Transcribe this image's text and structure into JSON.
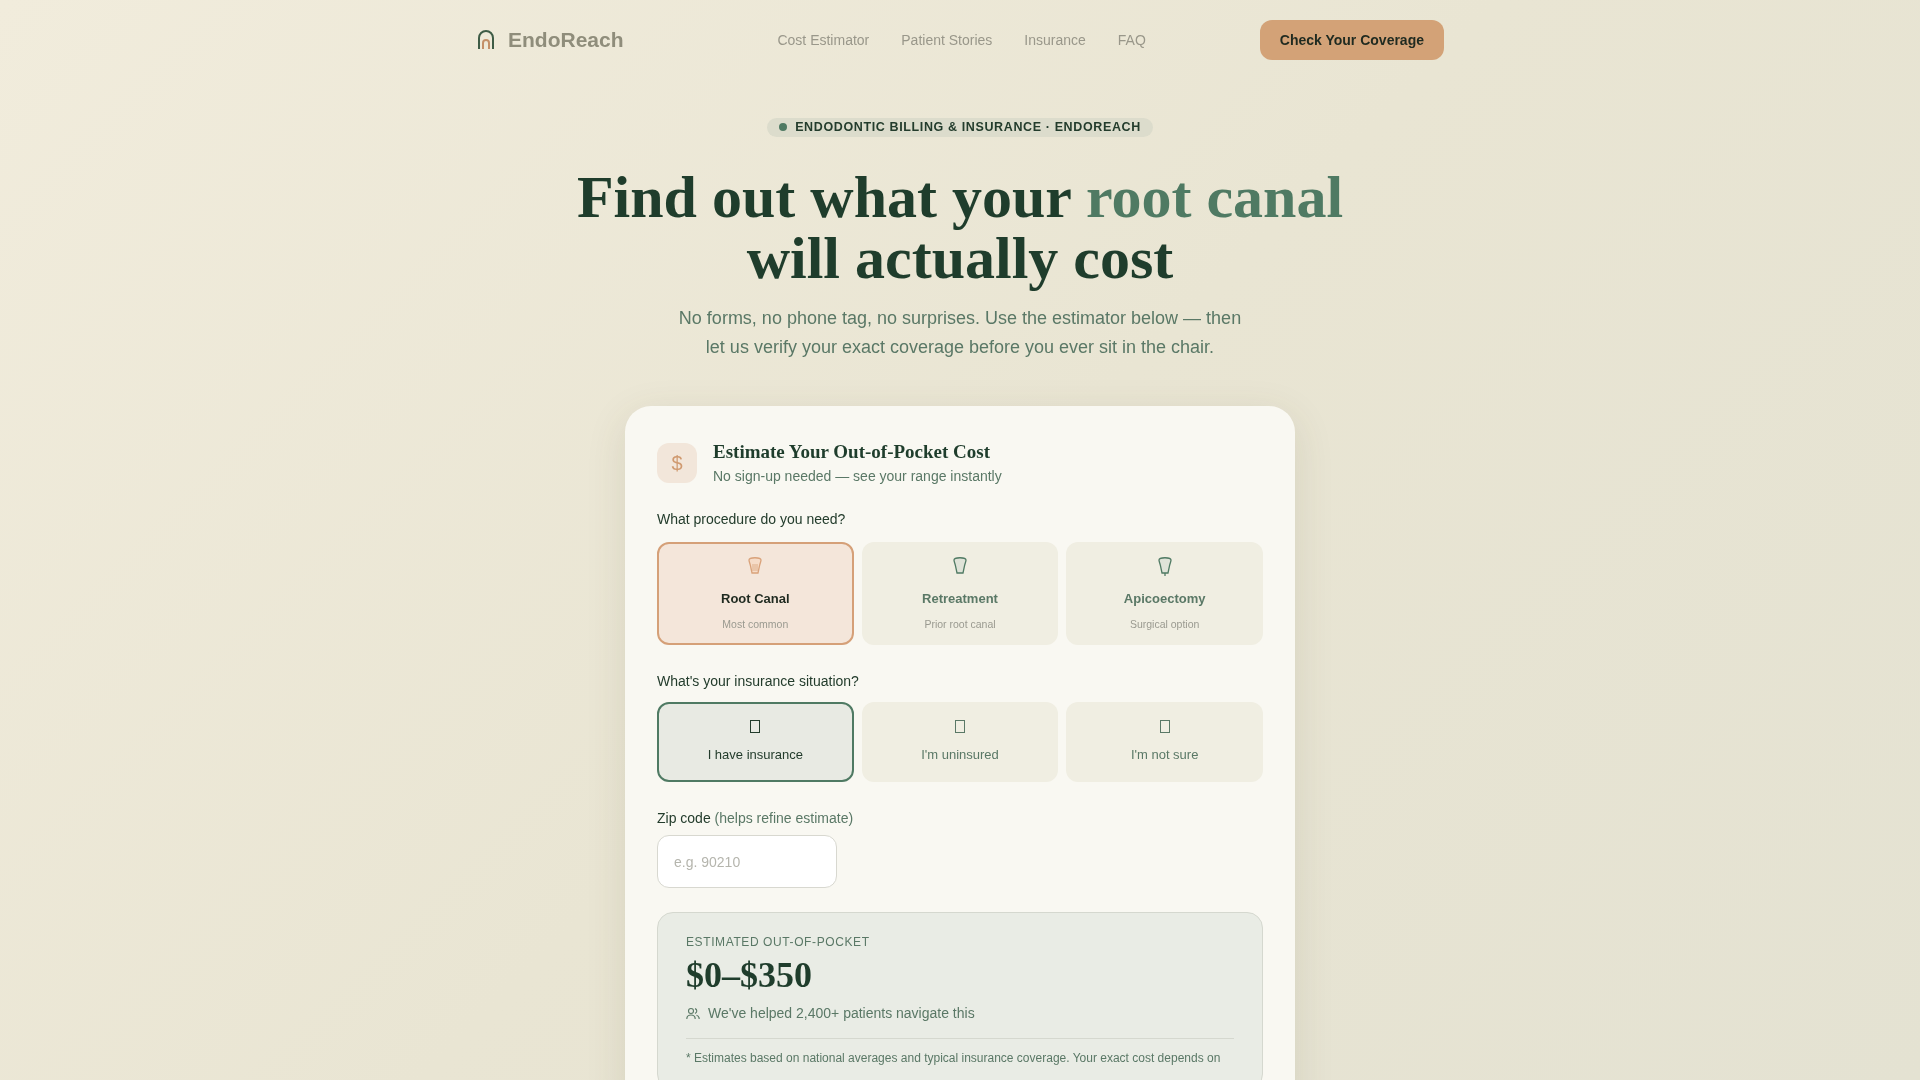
{
  "nav": {
    "brand": "EndoReach",
    "links": [
      "Cost Estimator",
      "Patient Stories",
      "Insurance",
      "FAQ"
    ],
    "cta": "Check Your Coverage"
  },
  "hero": {
    "badge": "ENDODONTIC BILLING & INSURANCE · ENDOREACH",
    "title_start": "Find out what your ",
    "title_accent": "root canal",
    "title_end": "will actually cost",
    "subtitle": "No forms, no phone tag, no surprises. Use the estimator below — then let us verify your exact coverage before you ever sit in the chair."
  },
  "estimator": {
    "icon_text": "$",
    "title": "Estimate Your Out-of-Pocket Cost",
    "subtitle": "No sign-up needed — see your range instantly",
    "procedure_label": "What procedure do you need?",
    "procedures": [
      {
        "name": "Root Canal",
        "note": "Most common",
        "selected": true
      },
      {
        "name": "Retreatment",
        "note": "Prior root canal",
        "selected": false
      },
      {
        "name": "Apicoectomy",
        "note": "Surgical option",
        "selected": false
      }
    ],
    "insurance_label": "What's your insurance situation?",
    "insurance_options": [
      {
        "label": "I have insurance",
        "selected": true
      },
      {
        "label": "I'm uninsured",
        "selected": false
      },
      {
        "label": "I'm not sure",
        "selected": false
      }
    ],
    "zip_label": "Zip code",
    "zip_hint": "(helps refine estimate)",
    "zip_placeholder": "e.g. 90210",
    "result": {
      "label": "ESTIMATED OUT-OF-POCKET",
      "range": "$0–$350",
      "social_proof": "We've helped 2,400+ patients navigate this",
      "footnote": "* Estimates based on national averages and typical insurance coverage. Your exact cost depends on"
    }
  }
}
